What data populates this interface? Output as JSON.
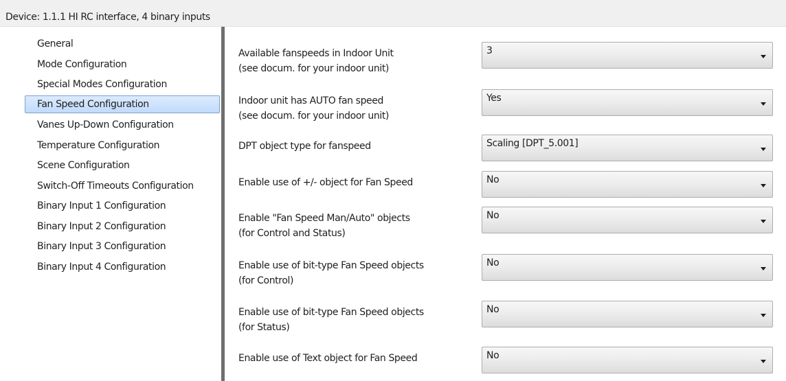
{
  "window": {
    "title": "Device: 1.1.1  HI RC interface, 4 binary inputs"
  },
  "sidebar": {
    "selected_index": 3,
    "items": [
      {
        "label": "General"
      },
      {
        "label": "Mode Configuration"
      },
      {
        "label": "Special Modes Configuration"
      },
      {
        "label": "Fan Speed Configuration"
      },
      {
        "label": "Vanes Up-Down Configuration"
      },
      {
        "label": "Temperature Configuration"
      },
      {
        "label": "Scene Configuration"
      },
      {
        "label": "Switch-Off Timeouts Configuration"
      },
      {
        "label": "Binary Input 1 Configuration"
      },
      {
        "label": "Binary Input 2 Configuration"
      },
      {
        "label": "Binary Input 3 Configuration"
      },
      {
        "label": "Binary Input 4 Configuration"
      }
    ]
  },
  "params": [
    {
      "line1": "Available fanspeeds in Indoor Unit",
      "line2": "(see docum. for your indoor unit)",
      "value": "3"
    },
    {
      "line1": "Indoor unit has AUTO fan speed",
      "line2": "(see docum. for your indoor unit)",
      "value": "Yes"
    },
    {
      "line1": "DPT object type for fanspeed",
      "line2": "",
      "value": "Scaling [DPT_5.001]"
    },
    {
      "line1": "Enable use of +/- object for Fan Speed",
      "line2": "",
      "value": "No"
    },
    {
      "line1": "Enable \"Fan Speed Man/Auto\" objects",
      "line2": "(for Control and Status)",
      "value": "No"
    },
    {
      "line1": "Enable use of bit-type Fan Speed objects",
      "line2": "(for Control)",
      "value": "No"
    },
    {
      "line1": "Enable use of bit-type Fan Speed objects",
      "line2": "(for Status)",
      "value": "No"
    },
    {
      "line1": "Enable use of Text object for Fan Speed",
      "line2": "",
      "value": "No"
    }
  ]
}
